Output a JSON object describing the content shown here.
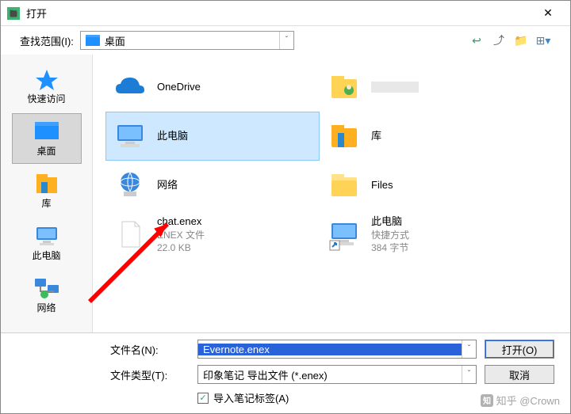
{
  "window": {
    "title": "打开"
  },
  "lookin": {
    "label": "查找范围(I):",
    "value": "桌面"
  },
  "sidebar": {
    "items": [
      {
        "label": "快速访问"
      },
      {
        "label": "桌面"
      },
      {
        "label": "库"
      },
      {
        "label": "此电脑"
      },
      {
        "label": "网络"
      }
    ]
  },
  "files": {
    "items": [
      {
        "name": "OneDrive",
        "sub1": "",
        "sub2": "",
        "icon": "onedrive"
      },
      {
        "name": "",
        "sub1": "",
        "sub2": "",
        "icon": "user",
        "blurred": true
      },
      {
        "name": "此电脑",
        "sub1": "",
        "sub2": "",
        "icon": "computer",
        "selected": true
      },
      {
        "name": "库",
        "sub1": "",
        "sub2": "",
        "icon": "libraries"
      },
      {
        "name": "网络",
        "sub1": "",
        "sub2": "",
        "icon": "network"
      },
      {
        "name": "Files",
        "sub1": "",
        "sub2": "",
        "icon": "folder"
      },
      {
        "name": "chat.enex",
        "sub1": "ENEX 文件",
        "sub2": "22.0 KB",
        "icon": "file"
      },
      {
        "name": "此电脑",
        "sub1": "快捷方式",
        "sub2": "384 字节",
        "icon": "shortcut"
      }
    ]
  },
  "filename": {
    "label": "文件名(N):",
    "value": "Evernote.enex"
  },
  "filetype": {
    "label": "文件类型(T):",
    "value": "印象笔记 导出文件 (*.enex)"
  },
  "checkbox": {
    "label": "导入笔记标签(A)",
    "checked": true
  },
  "buttons": {
    "open": "打开(O)",
    "cancel": "取消"
  },
  "watermark": {
    "text": "知乎 @Crown"
  }
}
